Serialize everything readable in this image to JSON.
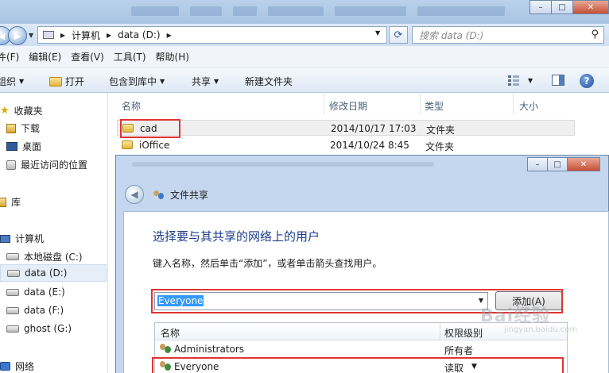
{
  "explorer": {
    "address": {
      "computer": "计算机",
      "drive": "data (D:)",
      "sep": "▸"
    },
    "search_placeholder": "搜索 data (D:)",
    "caption": {
      "minimize": "–",
      "maximize": "□",
      "close": "✕"
    },
    "menu": [
      "件(F)",
      "编辑(E)",
      "查看(V)",
      "工具(T)",
      "帮助(H)"
    ],
    "toolbar": {
      "organize": "组织",
      "open": "打开",
      "include": "包含到库中",
      "share": "共享",
      "new_folder": "新建文件夹"
    },
    "nav": {
      "favorites": "收藏夹",
      "downloads": "下载",
      "desktop": "桌面",
      "recent": "最近访问的位置",
      "libraries": "库",
      "computer": "计算机",
      "drives": [
        "本地磁盘 (C:)",
        "data (D:)",
        "data (E:)",
        "data (F:)",
        "ghost (G:)"
      ],
      "network": "网络"
    },
    "columns": {
      "name": "名称",
      "modified": "修改日期",
      "type": "类型",
      "size": "大小"
    },
    "files": [
      {
        "name": "cad",
        "modified": "2014/10/17 17:03",
        "type": "文件夹"
      },
      {
        "name": "iOffice",
        "modified": "2014/10/24 8:45",
        "type": "文件夹"
      }
    ]
  },
  "dialog": {
    "title": "文件共享",
    "heading": "选择要与其共享的网络上的用户",
    "instruction": "键入名称，然后单击“添加”，或者单击箭头查找用户。",
    "input_value": "Everyone",
    "add_button": "添加(A)",
    "table_headers": {
      "name": "名称",
      "permission": "权限级别"
    },
    "rows": [
      {
        "name": "Administrators",
        "permission": "所有者"
      },
      {
        "name": "Everyone",
        "permission": "读取"
      }
    ]
  },
  "watermark": {
    "brand": "Bai经验",
    "url": "jingyan.baidu.com"
  }
}
